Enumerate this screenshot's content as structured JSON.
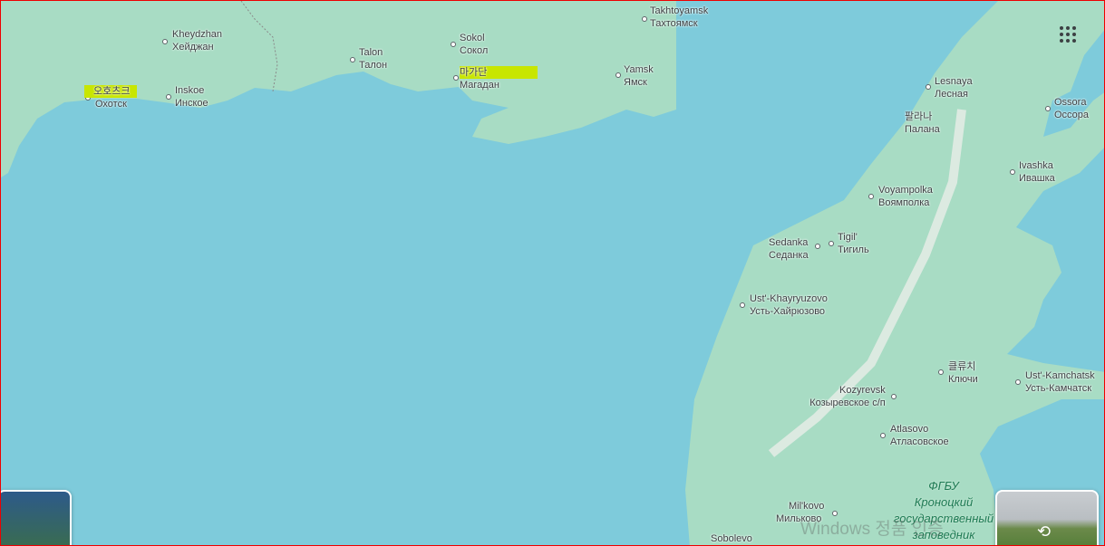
{
  "colors": {
    "water": "#7ecbdb",
    "land": "#a8dcc4",
    "highlight": "#c8e600"
  },
  "places": [
    {
      "id": "takhtoyamsk",
      "latin": "Takhtoyamsk",
      "local": "Тахтоямск"
    },
    {
      "id": "kheydzhan",
      "latin": "Kheydzhan",
      "local": "Хейджан"
    },
    {
      "id": "sokol",
      "latin": "Sokol",
      "local": "Сокол"
    },
    {
      "id": "talon",
      "latin": "Talon",
      "local": "Талон"
    },
    {
      "id": "magadan",
      "latin": "마가단",
      "local": "Магадан"
    },
    {
      "id": "yamsk",
      "latin": "Yamsk",
      "local": "Ямск"
    },
    {
      "id": "okhotsk",
      "latin": "오호츠크",
      "local": "Охотск"
    },
    {
      "id": "inskoe",
      "latin": "Inskoe",
      "local": "Инское"
    },
    {
      "id": "lesnaya",
      "latin": "Lesnaya",
      "local": "Лесная"
    },
    {
      "id": "ossora",
      "latin": "Ossora",
      "local": "Оссора"
    },
    {
      "id": "palana",
      "latin": "팔라나",
      "local": "Палана"
    },
    {
      "id": "ivashka",
      "latin": "Ivashka",
      "local": "Ивашка"
    },
    {
      "id": "voyampolka",
      "latin": "Voyampolka",
      "local": "Воямполка"
    },
    {
      "id": "sedanka",
      "latin": "Sedanka",
      "local": "Седанка"
    },
    {
      "id": "tigil",
      "latin": "Tigil'",
      "local": "Тигиль"
    },
    {
      "id": "ust-khayryuzovo",
      "latin": "Ust'-Khayryuzovo",
      "local": "Усть-Хайрюзово"
    },
    {
      "id": "klyuchi",
      "latin": "클류치",
      "local": "Ключи"
    },
    {
      "id": "ust-kamchatsk",
      "latin": "Ust'-Kamchatsk",
      "local": "Усть-Камчатск"
    },
    {
      "id": "kozyrevsk",
      "latin": "Kozyrevsk",
      "local": "Козыревское с/п"
    },
    {
      "id": "atlasovo",
      "latin": "Atlasovo",
      "local": "Атласовское"
    },
    {
      "id": "milkovo",
      "latin": "Mil'kovo",
      "local": "Мильково"
    },
    {
      "id": "sobolevo",
      "latin": "Sobolevo",
      "local": ""
    }
  ],
  "park": {
    "line1": "ФГБУ",
    "line2": "Кроноцкий",
    "line3": "государственный",
    "line4": "заповедник"
  },
  "watermark": "Windows 정품 인증"
}
